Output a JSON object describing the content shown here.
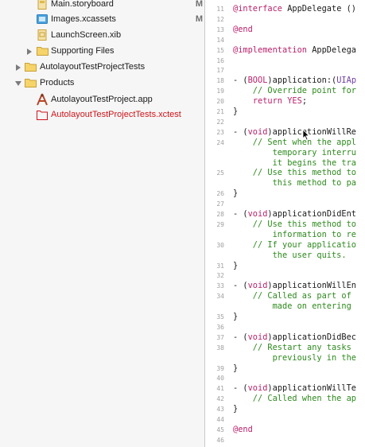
{
  "navigator": {
    "items": [
      {
        "label": "Main.storyboard",
        "badge": "M",
        "icon": "storyboard-icon",
        "color": "#1a1a1a"
      },
      {
        "label": "Images.xcassets",
        "badge": "M",
        "icon": "asset-catalog-icon",
        "color": "#1a1a1a"
      },
      {
        "label": "LaunchScreen.xib",
        "badge": "",
        "icon": "xib-icon",
        "color": "#1a1a1a"
      },
      {
        "label": "Supporting Files",
        "badge": "",
        "icon": "folder-icon",
        "color": "#1a1a1a"
      },
      {
        "label": "AutolayoutTestProjectTests",
        "badge": "",
        "icon": "folder-icon",
        "color": "#1a1a1a"
      },
      {
        "label": "Products",
        "badge": "",
        "icon": "folder-icon",
        "color": "#1a1a1a"
      },
      {
        "label": "AutolayoutTestProject.app",
        "badge": "",
        "icon": "app-icon",
        "color": "#1a1a1a"
      },
      {
        "label": "AutolayoutTestProjectTests.xctest",
        "badge": "",
        "icon": "xctest-icon",
        "color": "#d0141a"
      }
    ]
  },
  "editor": {
    "lines": [
      {
        "num": "11",
        "segments": [
          {
            "t": "@interface",
            "c": "kw"
          },
          {
            "t": " AppDelegate ()",
            "c": ""
          }
        ]
      },
      {
        "num": "12",
        "segments": []
      },
      {
        "num": "13",
        "segments": [
          {
            "t": "@end",
            "c": "kw"
          }
        ]
      },
      {
        "num": "14",
        "segments": []
      },
      {
        "num": "15",
        "segments": [
          {
            "t": "@implementation",
            "c": "kw"
          },
          {
            "t": " AppDelega",
            "c": ""
          }
        ]
      },
      {
        "num": "16",
        "segments": []
      },
      {
        "num": "17",
        "segments": []
      },
      {
        "num": "18",
        "segments": [
          {
            "t": "- (",
            "c": ""
          },
          {
            "t": "BOOL",
            "c": "kw"
          },
          {
            "t": ")application:(",
            "c": ""
          },
          {
            "t": "UIAp",
            "c": "ty"
          }
        ]
      },
      {
        "num": "19",
        "segments": [
          {
            "t": "    // Override point for",
            "c": "cm"
          }
        ]
      },
      {
        "num": "20",
        "segments": [
          {
            "t": "    ",
            "c": ""
          },
          {
            "t": "return",
            "c": "kw"
          },
          {
            "t": " ",
            "c": ""
          },
          {
            "t": "YES",
            "c": "kw"
          },
          {
            "t": ";",
            "c": ""
          }
        ]
      },
      {
        "num": "21",
        "segments": [
          {
            "t": "}",
            "c": ""
          }
        ]
      },
      {
        "num": "22",
        "segments": []
      },
      {
        "num": "23",
        "segments": [
          {
            "t": "- (",
            "c": ""
          },
          {
            "t": "void",
            "c": "kw"
          },
          {
            "t": ")applicationWillRe",
            "c": ""
          }
        ]
      },
      {
        "num": "24",
        "segments": [
          {
            "t": "    // Sent when the appl",
            "c": "cm"
          }
        ]
      },
      {
        "num": "",
        "segments": [
          {
            "t": "        temporary interru",
            "c": "cm"
          }
        ]
      },
      {
        "num": "",
        "segments": [
          {
            "t": "        it begins the tra",
            "c": "cm"
          }
        ]
      },
      {
        "num": "25",
        "segments": [
          {
            "t": "    // Use this method to",
            "c": "cm"
          }
        ]
      },
      {
        "num": "",
        "segments": [
          {
            "t": "        this method to pa",
            "c": "cm"
          }
        ]
      },
      {
        "num": "26",
        "segments": [
          {
            "t": "}",
            "c": ""
          }
        ]
      },
      {
        "num": "27",
        "segments": []
      },
      {
        "num": "28",
        "segments": [
          {
            "t": "- (",
            "c": ""
          },
          {
            "t": "void",
            "c": "kw"
          },
          {
            "t": ")applicationDidEnt",
            "c": ""
          }
        ]
      },
      {
        "num": "29",
        "segments": [
          {
            "t": "    // Use this method to",
            "c": "cm"
          }
        ]
      },
      {
        "num": "",
        "segments": [
          {
            "t": "        information to re",
            "c": "cm"
          }
        ]
      },
      {
        "num": "30",
        "segments": [
          {
            "t": "    // If your applicatio",
            "c": "cm"
          }
        ]
      },
      {
        "num": "",
        "segments": [
          {
            "t": "        the user quits.",
            "c": "cm"
          }
        ]
      },
      {
        "num": "31",
        "segments": [
          {
            "t": "}",
            "c": ""
          }
        ]
      },
      {
        "num": "32",
        "segments": []
      },
      {
        "num": "33",
        "segments": [
          {
            "t": "- (",
            "c": ""
          },
          {
            "t": "void",
            "c": "kw"
          },
          {
            "t": ")applicationWillEn",
            "c": ""
          }
        ]
      },
      {
        "num": "34",
        "segments": [
          {
            "t": "    // Called as part of",
            "c": "cm"
          }
        ]
      },
      {
        "num": "",
        "segments": [
          {
            "t": "        made on entering",
            "c": "cm"
          }
        ]
      },
      {
        "num": "35",
        "segments": [
          {
            "t": "}",
            "c": ""
          }
        ]
      },
      {
        "num": "36",
        "segments": []
      },
      {
        "num": "37",
        "segments": [
          {
            "t": "- (",
            "c": ""
          },
          {
            "t": "void",
            "c": "kw"
          },
          {
            "t": ")applicationDidBec",
            "c": ""
          }
        ]
      },
      {
        "num": "38",
        "segments": [
          {
            "t": "    // Restart any tasks",
            "c": "cm"
          }
        ]
      },
      {
        "num": "",
        "segments": [
          {
            "t": "        previously in the",
            "c": "cm"
          }
        ]
      },
      {
        "num": "39",
        "segments": [
          {
            "t": "}",
            "c": ""
          }
        ]
      },
      {
        "num": "40",
        "segments": []
      },
      {
        "num": "41",
        "segments": [
          {
            "t": "- (",
            "c": ""
          },
          {
            "t": "void",
            "c": "kw"
          },
          {
            "t": ")applicationWillTe",
            "c": ""
          }
        ]
      },
      {
        "num": "42",
        "segments": [
          {
            "t": "    // Called when the ap",
            "c": "cm"
          }
        ]
      },
      {
        "num": "43",
        "segments": [
          {
            "t": "}",
            "c": ""
          }
        ]
      },
      {
        "num": "44",
        "segments": []
      },
      {
        "num": "45",
        "segments": [
          {
            "t": "@end",
            "c": "kw"
          }
        ]
      },
      {
        "num": "46",
        "segments": []
      }
    ]
  }
}
